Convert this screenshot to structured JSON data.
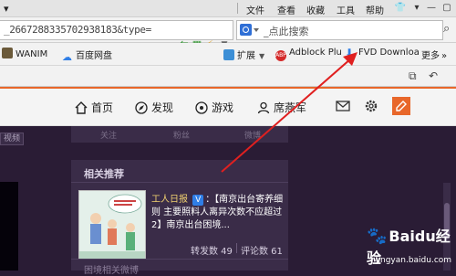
{
  "menubar": {
    "items": [
      "文件",
      "查看",
      "收藏",
      "工具",
      "帮助"
    ]
  },
  "address": {
    "url": "_2667288335702938183&type=",
    "search_placeholder": "_点此搜索"
  },
  "bookmarks": {
    "items": [
      "WANIM",
      "百度网盘",
      "扩展",
      "Adblock Plu",
      "FVD Downloa",
      "更多"
    ],
    "more_chevron": "»"
  },
  "site_nav": {
    "items": [
      "首页",
      "发现",
      "游戏",
      "席燕军"
    ]
  },
  "profile": {
    "stats": [
      "关注",
      "粉丝",
      "微博"
    ],
    "left_tag": "视频"
  },
  "related": {
    "title": "相关推荐",
    "author": "工人日报",
    "verified_badge": "V",
    "post_text": "：【南京出台寄养细则 主要照料人离异次数不应超过2】南京出台困境...",
    "reposts": "转发数 49",
    "comments": "评论数 61",
    "next_title": "困境相关微博"
  },
  "watermark": {
    "brand": "Baidu经验",
    "site": "jingyan.baidu.com"
  },
  "colors": {
    "accent": "#e8672a",
    "page_bg": "#2a1c35",
    "arrow": "#e02020",
    "link": "#e8e0a0"
  }
}
